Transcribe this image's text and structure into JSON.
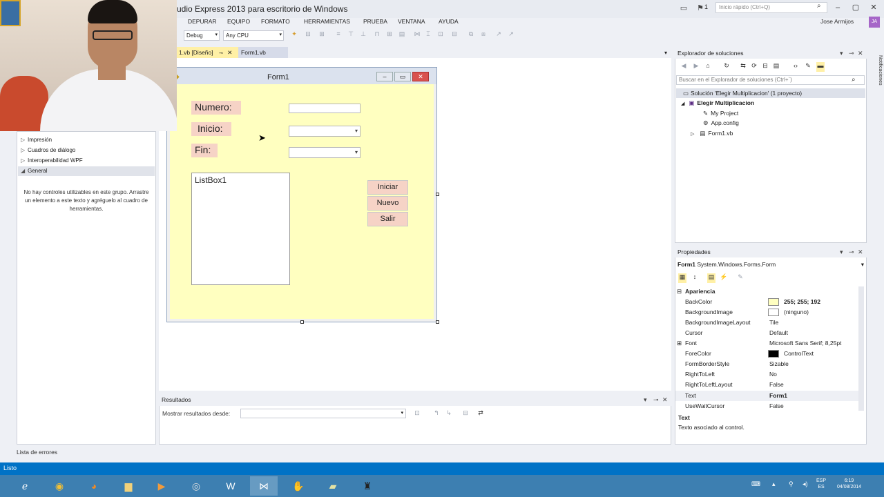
{
  "window": {
    "title": "udio Express 2013 para escritorio de Windows",
    "quick_launch_placeholder": "Inicio rápido (Ctrl+Q)",
    "flag_count": "1",
    "user_name": "Jose Armijos",
    "user_initials": "JA"
  },
  "menu": [
    "DEPURAR",
    "EQUIPO",
    "FORMATO",
    "HERRAMIENTAS",
    "PRUEBA",
    "VENTANA",
    "AYUDA"
  ],
  "toolbar": {
    "configuration": "Debug",
    "platform": "Any CPU"
  },
  "toolbox": {
    "items": [
      {
        "label": "Impresión",
        "expanded": false
      },
      {
        "label": "Cuadros de diálogo",
        "expanded": false
      },
      {
        "label": "Interoperabilidad WPF",
        "expanded": false
      },
      {
        "label": "General",
        "expanded": true
      }
    ],
    "empty_message": "No hay controles utilizables en este grupo. Arrastre un elemento a este texto y agréguelo al cuadro de herramientas."
  },
  "doc_tabs": [
    {
      "label": "1.vb [Diseño]",
      "active": true
    },
    {
      "label": "Form1.vb",
      "active": false
    }
  ],
  "form": {
    "title": "Form1",
    "back_color": "#ffffc0",
    "label_color": "#f6d3c6",
    "labels": {
      "numero": "Numero:",
      "inicio": "Inicio:",
      "fin": "Fin:"
    },
    "listbox": "ListBox1",
    "buttons": {
      "iniciar": "Iniciar",
      "nuevo": "Nuevo",
      "salir": "Salir"
    }
  },
  "output": {
    "title": "Resultados",
    "show_from_label": "Mostrar resultados desde:"
  },
  "solution_explorer": {
    "title": "Explorador de soluciones",
    "search_placeholder": "Buscar en el Explorador de soluciones (Ctrl+`)",
    "solution": "Solución 'Elegir Multiplicacion' (1 proyecto)",
    "project": "Elegir Multiplicacion",
    "items": [
      "My Project",
      "App.config",
      "Form1.vb"
    ]
  },
  "properties": {
    "title": "Propiedades",
    "object_name": "Form1",
    "object_type": "System.Windows.Forms.Form",
    "category": "Apariencia",
    "rows": [
      {
        "name": "BackColor",
        "value": "255; 255; 192",
        "swatch": "#ffffc0"
      },
      {
        "name": "BackgroundImage",
        "value": "(ninguno)",
        "swatch": "#ffffff"
      },
      {
        "name": "BackgroundImageLayout",
        "value": "Tile"
      },
      {
        "name": "Cursor",
        "value": "Default"
      },
      {
        "name": "Font",
        "value": "Microsoft Sans Serif; 8,25pt"
      },
      {
        "name": "ForeColor",
        "value": "ControlText",
        "swatch": "#000000"
      },
      {
        "name": "FormBorderStyle",
        "value": "Sizable"
      },
      {
        "name": "RightToLeft",
        "value": "No"
      },
      {
        "name": "RightToLeftLayout",
        "value": "False"
      },
      {
        "name": "Text",
        "value": "Form1"
      },
      {
        "name": "UseWaitCursor",
        "value": "False"
      }
    ],
    "desc_title": "Text",
    "desc_text": "Texto asociado al control."
  },
  "right_edge_tab": "Notificaciones",
  "bottom": {
    "error_list_tab": "Lista de errores",
    "status": "Listo"
  },
  "taskbar": {
    "lang_top": "ESP",
    "lang_bottom": "ES",
    "time": "6:19",
    "date": "04/08/2014"
  }
}
